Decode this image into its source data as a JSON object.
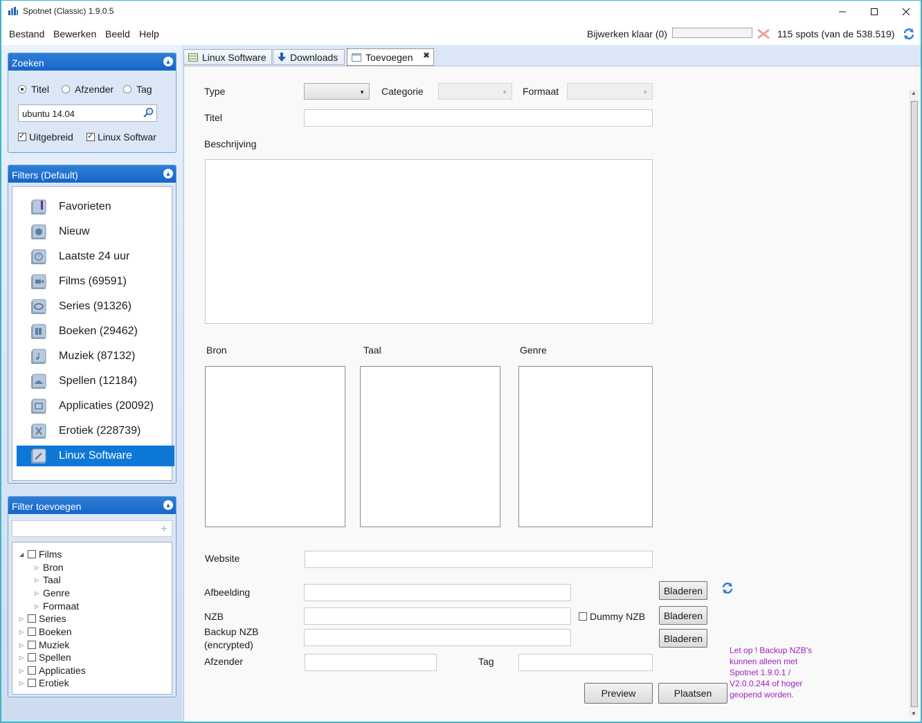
{
  "window": {
    "title": "Spotnet (Classic) 1.9.0.5"
  },
  "menu": {
    "items": [
      {
        "label": "Bestand"
      },
      {
        "label": "Bewerken"
      },
      {
        "label": "Beeld"
      },
      {
        "label": "Help"
      }
    ]
  },
  "status": {
    "update_text": "Bijwerken klaar (0)",
    "progress": 0,
    "spots_text": "115 spots (van de 538.519)"
  },
  "search": {
    "header": "Zoeken",
    "radio_titel": "Titel",
    "radio_afzender": "Afzender",
    "radio_tag": "Tag",
    "selected": "Titel",
    "query": "ubuntu 14.04",
    "check_uitgebreid": "Uitgebreid",
    "check_linux": "Linux Softwar"
  },
  "filters": {
    "header": "Filters (Default)",
    "items": [
      {
        "label": "Favorieten"
      },
      {
        "label": "Nieuw"
      },
      {
        "label": "Laatste 24 uur"
      },
      {
        "label": "Films (69591)"
      },
      {
        "label": "Series (91326)"
      },
      {
        "label": "Boeken (29462)"
      },
      {
        "label": "Muziek (87132)"
      },
      {
        "label": "Spellen (12184)"
      },
      {
        "label": "Applicaties (20092)"
      },
      {
        "label": "Erotiek (228739)"
      },
      {
        "label": "Linux Software"
      }
    ],
    "selected": "Linux Software"
  },
  "filter_add": {
    "header": "Filter toevoegen",
    "input_value": "",
    "tree": {
      "films": "Films",
      "bron": "Bron",
      "taal": "Taal",
      "genre": "Genre",
      "formaat": "Formaat",
      "series": "Series",
      "boeken": "Boeken",
      "muziek": "Muziek",
      "spellen": "Spellen",
      "applicaties": "Applicaties",
      "erotiek": "Erotiek"
    }
  },
  "tabs": [
    {
      "label": "Linux Software"
    },
    {
      "label": "Downloads"
    },
    {
      "label": "Toevoegen"
    }
  ],
  "form": {
    "type_label": "Type",
    "categorie_label": "Categorie",
    "formaat_label": "Formaat",
    "titel_label": "Titel",
    "beschrijving_label": "Beschrijving",
    "bron_label": "Bron",
    "taal_label": "Taal",
    "genre_label": "Genre",
    "website_label": "Website",
    "afbeelding_label": "Afbeelding",
    "nzb_label": "NZB",
    "backup_nzb_label": "Backup NZB",
    "backup_nzb_sub": "(encrypted)",
    "afzender_label": "Afzender",
    "tag_label": "Tag",
    "dummy_nzb_label": "Dummy NZB",
    "browse_label": "Bladeren",
    "preview_label": "Preview",
    "plaatsen_label": "Plaatsen",
    "note_line1": "Let op ! Backup NZB's",
    "note_line2": "kunnen alleen met",
    "note_line3": "Spotnet 1.9.0.1 /",
    "note_line4": "V2.0.0.244 of hoger",
    "note_line5": "geopend worden."
  },
  "colors": {
    "accent": "#0e78d7",
    "panel_header": "#1565c8",
    "note": "#a020c0",
    "window_border": "#3fb3c7"
  }
}
